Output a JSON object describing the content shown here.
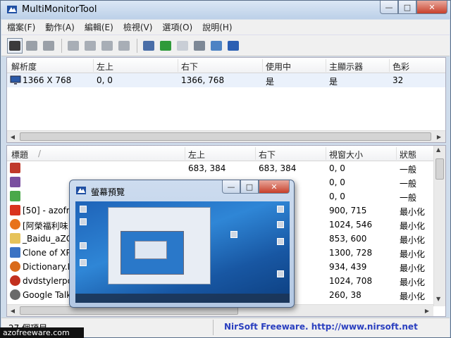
{
  "window": {
    "title": "MultiMonitorTool"
  },
  "menu": [
    "檔案(F)",
    "動作(A)",
    "編輯(E)",
    "檢視(V)",
    "選項(O)",
    "說明(H)"
  ],
  "monitors": {
    "columns": [
      "解析度",
      "左上",
      "右下",
      "使用中",
      "主顯示器",
      "色彩"
    ],
    "rows": [
      {
        "res": "1366 X 768",
        "tl": "0, 0",
        "br": "1366, 768",
        "active": "是",
        "primary": "是",
        "color": "32"
      }
    ]
  },
  "windows": {
    "columns": [
      "標題",
      "左上",
      "右下",
      "視窗大小",
      "狀態"
    ],
    "rows": [
      {
        "title": "",
        "tl": "683, 384",
        "br": "683, 384",
        "size": "0, 0",
        "state": "一般",
        "icon_color": "#c0392b"
      },
      {
        "title": "",
        "tl": "",
        "br": "",
        "size": "0, 0",
        "state": "一般",
        "icon_color": "#7a4fa0"
      },
      {
        "title": "",
        "tl": "",
        "br": "",
        "size": "0, 0",
        "state": "一般",
        "icon_color": "#4aa84a"
      },
      {
        "title": "[50] - azofre",
        "tl": "",
        "br": "",
        "size": "900, 715",
        "state": "最小化",
        "icon_color": "#d9331f"
      },
      {
        "title": "[阿榮福利味",
        "tl": "",
        "br": "",
        "size": "1024, 546",
        "state": "最小化",
        "icon_color": "#e8731c"
      },
      {
        "title": "_Baidu_aZG",
        "tl": "",
        "br": "",
        "size": "853, 600",
        "state": "最小化",
        "icon_color": "#e6c35a"
      },
      {
        "title": "Clone of XP",
        "tl": "",
        "br": "",
        "size": "1300, 728",
        "state": "最小化",
        "icon_color": "#3b73c4"
      },
      {
        "title": "Dictionary.N",
        "tl": "",
        "br": "",
        "size": "934, 439",
        "state": "最小化",
        "icon_color": "#d96a1a"
      },
      {
        "title": "dvdstylerpo",
        "tl": "",
        "br": "",
        "size": "1024, 708",
        "state": "最小化",
        "icon_color": "#c2301e"
      },
      {
        "title": "Google Talk",
        "tl": "",
        "br": "",
        "size": "260, 38",
        "state": "最小化",
        "icon_color": "#6a6a6a"
      }
    ]
  },
  "status": {
    "count": "27 個項目",
    "link": "NirSoft Freeware.  http://www.nirsoft.net"
  },
  "preview": {
    "title": "螢幕預覽"
  },
  "watermark": "azofreeware.com",
  "colors": {
    "accent": "#2a3fbf",
    "close": "#c7402b"
  }
}
